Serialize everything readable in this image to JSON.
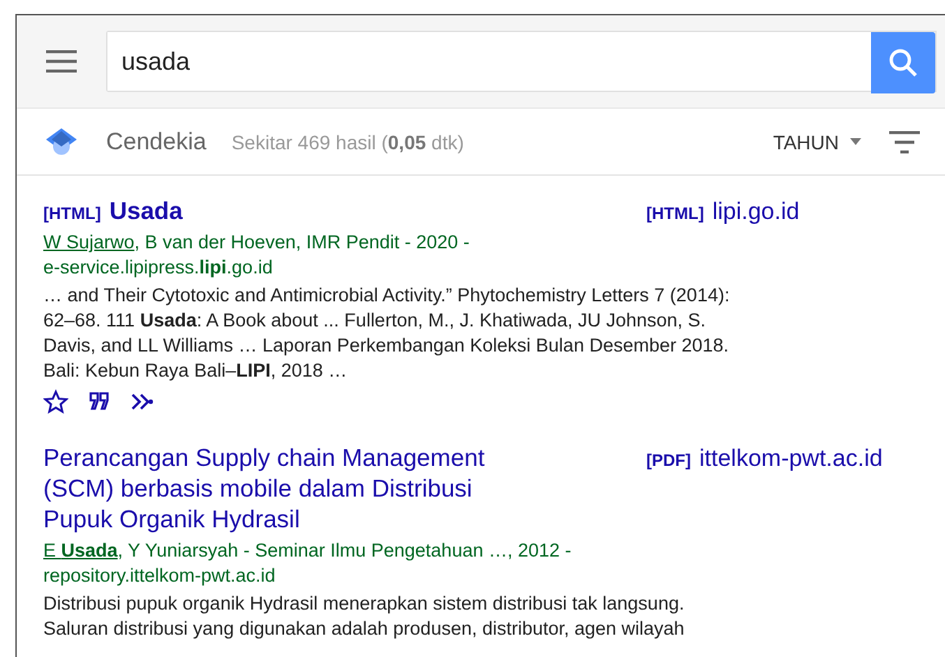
{
  "search": {
    "value": "usada"
  },
  "toolbar": {
    "brand": "Cendekia",
    "stats": "Sekitar 469 hasil (**0,05** dtk)",
    "sort": "TAHUN"
  },
  "results": [
    {
      "tag": "[HTML]",
      "title": "Usada",
      "title_bold": true,
      "author_link": "W Sujarwo",
      "authors_rest": ", B van der Hoeven, IMR Pendit - 2020 -",
      "source": "e-service.lipipress.**lipi**.go.id",
      "snippet": "… and Their Cytotoxic and Antimicrobial Activity.” Phytochemistry Letters 7 (2014): 62–68. 111 **Usada**: A Book about ... Fullerton, M., J. Khatiwada, JU Johnson, S. Davis, and LL Williams … Laporan Perkembangan Koleksi Bulan Desember 2018. Bali: Kebun Raya Bali–**LIPI**, 2018 …",
      "side_tag": "[HTML]",
      "side_link": "lipi.go.id",
      "actions": true
    },
    {
      "title": "Perancangan Supply chain Management (SCM) berbasis mobile dalam Distribusi Pupuk Organik Hydrasil",
      "title_bold": false,
      "author_link": "E **Usada**",
      "authors_rest": ", Y Yuniarsyah - Seminar Ilmu Pengetahuan …, 2012 -",
      "source": "repository.ittelkom-pwt.ac.id",
      "snippet": "Distribusi pupuk organik Hydrasil menerapkan sistem distribusi tak langsung. Saluran distribusi yang digunakan adalah produsen, distributor, agen wilayah",
      "side_tag": "[PDF]",
      "side_link": "ittelkom-pwt.ac.id",
      "actions": false
    }
  ]
}
